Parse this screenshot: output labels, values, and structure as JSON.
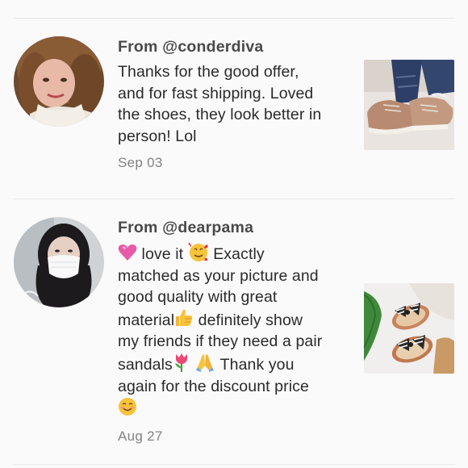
{
  "reviews": [
    {
      "author_label": "From @conderdiva",
      "lines": [
        "Thanks for the good offer,",
        "and for fast shipping. Loved",
        "the shoes, they look better in",
        "person! Lol"
      ],
      "date": "Sep 03",
      "avatar_icon": "avatar-photo-woman-blonde",
      "photo_icon": "photo-tan-sneakers"
    },
    {
      "author_label": "From @dearpama",
      "lines": [
        " love it ",
        " Exactly",
        "matched as your picture and",
        "good quality with great",
        "material",
        " definitely show",
        "my friends if they need a pair",
        "sandals",
        " ",
        " Thank you",
        "again for the discount price"
      ],
      "date": "Aug 27",
      "avatar_icon": "avatar-photo-woman-mask",
      "photo_icon": "photo-striped-bow-sandals",
      "emojis": [
        "pink-heart",
        "smiling-face-with-hearts",
        "thumbs-up",
        "tulip",
        "folded-hands",
        "smiling-face"
      ]
    }
  ],
  "colors": {
    "background": "#fbfafb",
    "divider": "#e8e5e7",
    "author": "#4a4a4a",
    "text": "#2a2a2a",
    "date": "#828282"
  }
}
